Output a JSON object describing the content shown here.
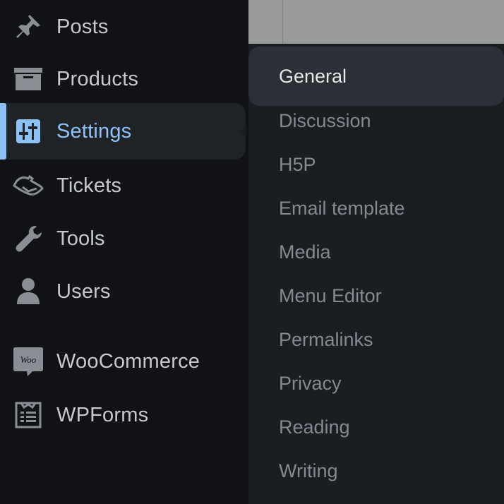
{
  "sidebar": {
    "items": [
      {
        "label": "Posts",
        "icon": "pin-icon"
      },
      {
        "label": "Products",
        "icon": "archive-box-icon"
      },
      {
        "label": "Settings",
        "icon": "settings-sliders-icon",
        "active": true
      },
      {
        "label": "Tickets",
        "icon": "ticket-icon"
      },
      {
        "label": "Tools",
        "icon": "wrench-icon"
      },
      {
        "label": "Users",
        "icon": "user-icon"
      },
      {
        "label": "WooCommerce",
        "icon": "woocommerce-icon"
      },
      {
        "label": "WPForms",
        "icon": "form-icon"
      }
    ]
  },
  "woo_icon_text": "Woo",
  "submenu": {
    "items": [
      {
        "label": "General",
        "current": true
      },
      {
        "label": "Discussion"
      },
      {
        "label": "H5P"
      },
      {
        "label": "Email template"
      },
      {
        "label": "Media"
      },
      {
        "label": "Menu Editor"
      },
      {
        "label": "Permalinks"
      },
      {
        "label": "Privacy"
      },
      {
        "label": "Reading"
      },
      {
        "label": "Writing"
      }
    ]
  },
  "colors": {
    "sidebar_bg": "#101216",
    "submenu_bg": "#1a1d21",
    "accent": "#8ec2f5",
    "text": "#c6c8cc",
    "submenu_text": "#868a90",
    "current_text": "#e6e7e9"
  }
}
